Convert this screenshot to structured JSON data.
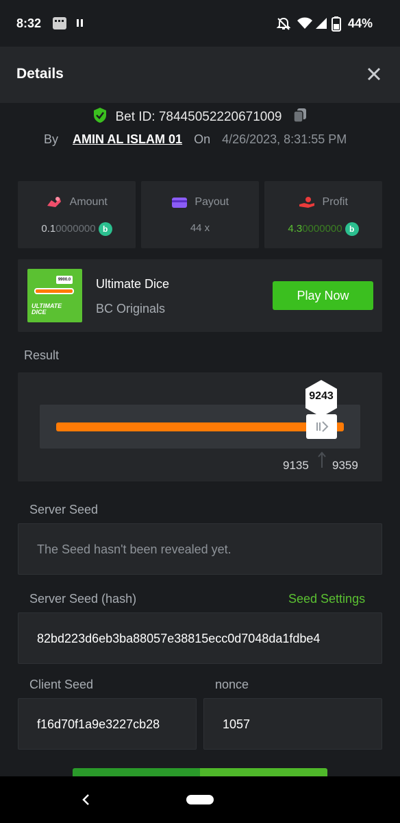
{
  "status_bar": {
    "time": "8:32",
    "battery": "44%"
  },
  "header": {
    "title": "Details"
  },
  "bet": {
    "id_label": "Bet ID: 78445052220671009",
    "by_label": "By",
    "username": "AMIN AL ISLAM 01",
    "on_label": "On",
    "datetime": "4/26/2023, 8:31:55 PM"
  },
  "stats": {
    "amount": {
      "label": "Amount",
      "value_bright": "0.1",
      "value_dim": "0000000"
    },
    "payout": {
      "label": "Payout",
      "value": "44 x"
    },
    "profit": {
      "label": "Profit",
      "value_bright": "4.3",
      "value_dim": "0000000"
    }
  },
  "game": {
    "name": "Ultimate Dice",
    "provider": "BC Originals",
    "thumb_title": "ULTIMATE DICE",
    "thumb_badge": "9900.0",
    "play_label": "Play Now"
  },
  "result": {
    "label": "Result",
    "roll": "9243",
    "range_min": "9135",
    "range_max": "9359"
  },
  "server_seed": {
    "label": "Server Seed",
    "value": "The Seed hasn't been revealed yet."
  },
  "server_seed_hash": {
    "label": "Server Seed (hash)",
    "settings_link": "Seed Settings",
    "value": "82bd223d6eb3ba88057e38815ecc0d7048da1fdbe4"
  },
  "client_seed": {
    "label": "Client Seed",
    "value": "f16d70f1a9e3227cb28"
  },
  "nonce": {
    "label": "nonce",
    "value": "1057"
  },
  "colors": {
    "accent_green": "#3bbf1f",
    "track_orange": "#ff7b06",
    "coin": "#2bbf8f",
    "panel": "#25272a",
    "background": "#1a1c1f"
  }
}
